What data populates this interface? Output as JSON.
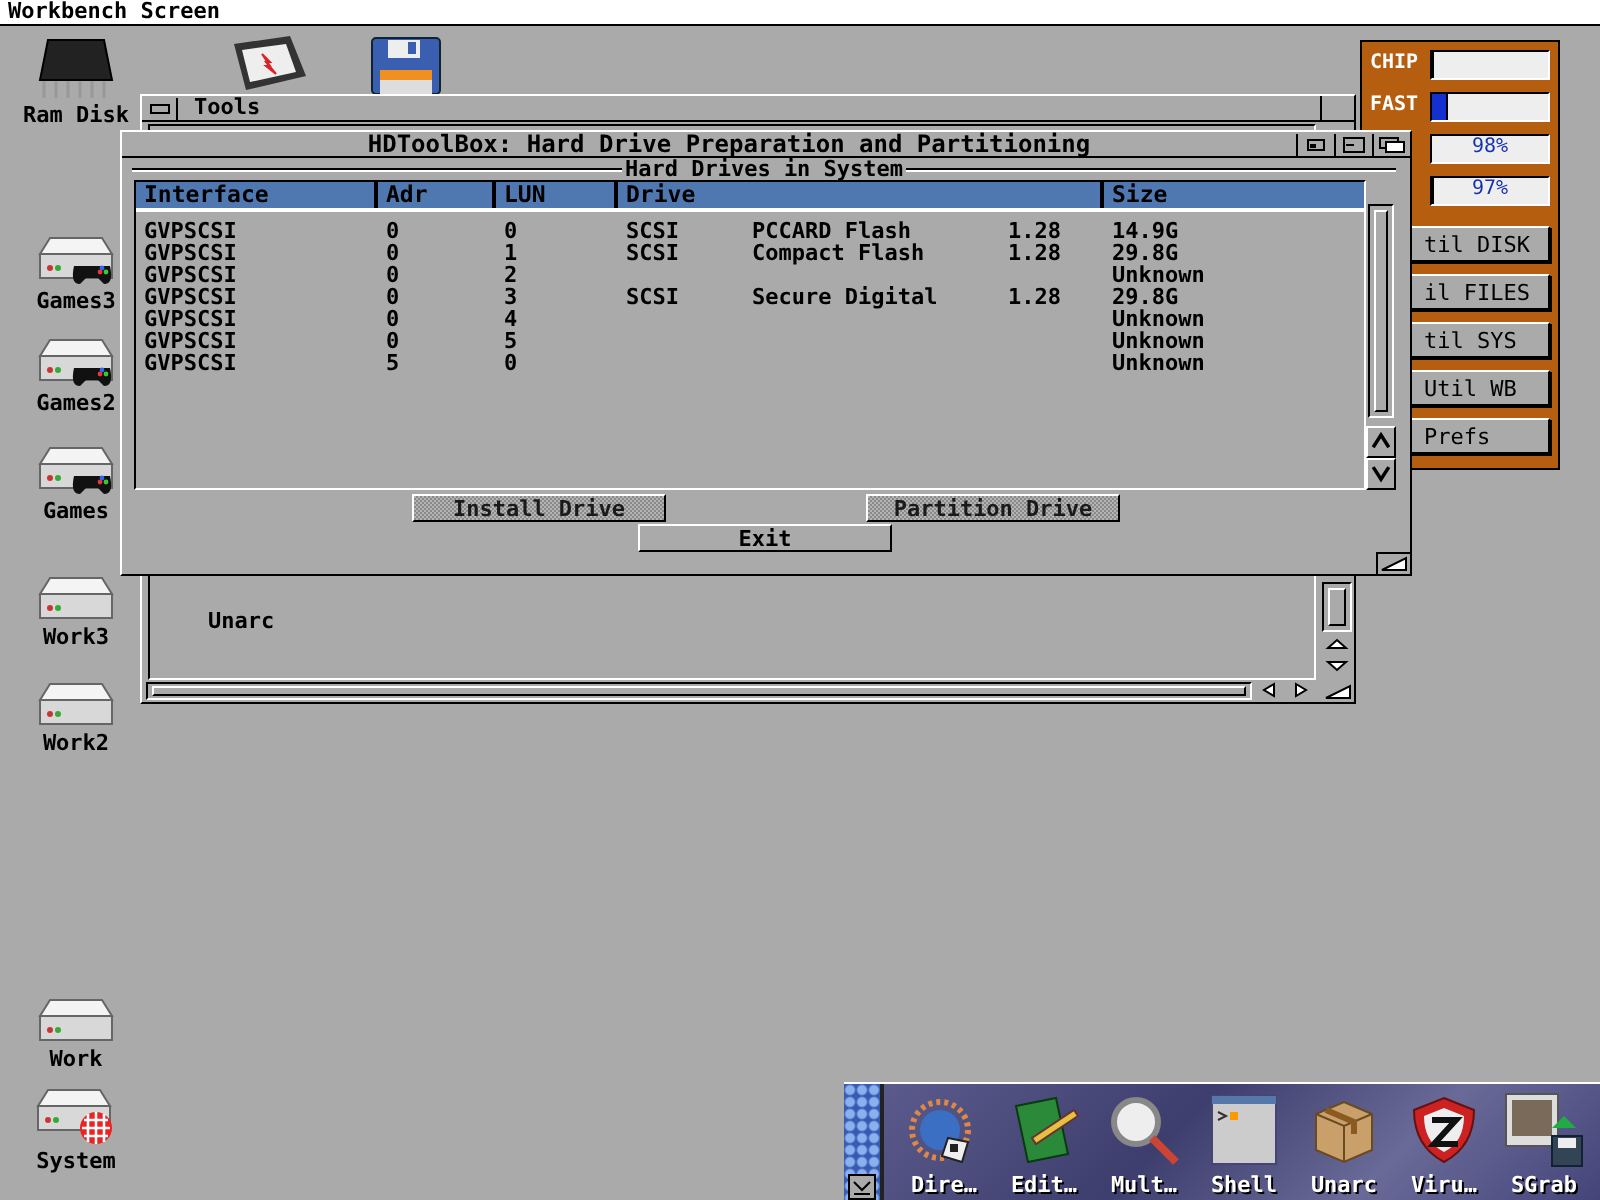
{
  "screen_title": "Workbench Screen",
  "desktop_icons": [
    {
      "kind": "ram",
      "label": "Ram Disk"
    },
    {
      "kind": "tools"
    },
    {
      "kind": "floppy"
    },
    {
      "kind": "games",
      "label": "Games3"
    },
    {
      "kind": "games",
      "label": "Games2"
    },
    {
      "kind": "games",
      "label": "Games"
    },
    {
      "kind": "drive",
      "label": "Work3"
    },
    {
      "kind": "drive",
      "label": "Work2"
    },
    {
      "kind": "drive",
      "label": "Work"
    },
    {
      "kind": "system",
      "label": "System"
    }
  ],
  "tools_window": {
    "title": "Tools",
    "icon_labels": [
      "Unarc"
    ]
  },
  "monitor_panel": {
    "meters": [
      {
        "label": "CHIP",
        "level": 0.02
      },
      {
        "label": "FAST",
        "level": 0.14
      },
      {
        "reading": "98%"
      },
      {
        "reading": "97%",
        "level": 0.02
      }
    ],
    "buttons": [
      "til DISK",
      "il FILES",
      "til SYS",
      "Util WB",
      "Prefs"
    ]
  },
  "hdtoolbox": {
    "title": "HDToolBox: Hard Drive Preparation and Partitioning",
    "group_title": "Hard Drives in System",
    "columns": [
      "Interface",
      "Adr",
      "LUN",
      "Drive",
      "Size"
    ],
    "rows": [
      {
        "interface": "GVPSCSI",
        "adr": "0",
        "lun": "0",
        "drive_type": "SCSI",
        "drive_name": "PCCARD Flash",
        "revision": "1.28",
        "size": "14.9G"
      },
      {
        "interface": "GVPSCSI",
        "adr": "0",
        "lun": "1",
        "drive_type": "SCSI",
        "drive_name": "Compact Flash",
        "revision": "1.28",
        "size": "29.8G"
      },
      {
        "interface": "GVPSCSI",
        "adr": "0",
        "lun": "2",
        "size": "Unknown"
      },
      {
        "interface": "GVPSCSI",
        "adr": "0",
        "lun": "3",
        "drive_type": "SCSI",
        "drive_name": "Secure Digital",
        "revision": "1.28",
        "size": "29.8G"
      },
      {
        "interface": "GVPSCSI",
        "adr": "0",
        "lun": "4",
        "size": "Unknown"
      },
      {
        "interface": "GVPSCSI",
        "adr": "0",
        "lun": "5",
        "size": "Unknown"
      },
      {
        "interface": "GVPSCSI",
        "adr": "5",
        "lun": "0",
        "size": "Unknown"
      }
    ],
    "buttons": [
      {
        "label": "Install Drive",
        "disabled": true
      },
      {
        "label": "Partition Drive",
        "disabled": true
      },
      {
        "label": "Exit",
        "disabled": false
      }
    ]
  },
  "dock": {
    "items": [
      {
        "kind": "globe",
        "label": "Dire…"
      },
      {
        "kind": "notebook",
        "label": "Edit…"
      },
      {
        "kind": "magnifier",
        "label": "Mult…"
      },
      {
        "kind": "terminal",
        "label": "Shell"
      },
      {
        "kind": "box",
        "label": "Unarc"
      },
      {
        "kind": "shield",
        "label": "Viru…"
      },
      {
        "kind": "picture",
        "label": "SGrab"
      }
    ]
  }
}
